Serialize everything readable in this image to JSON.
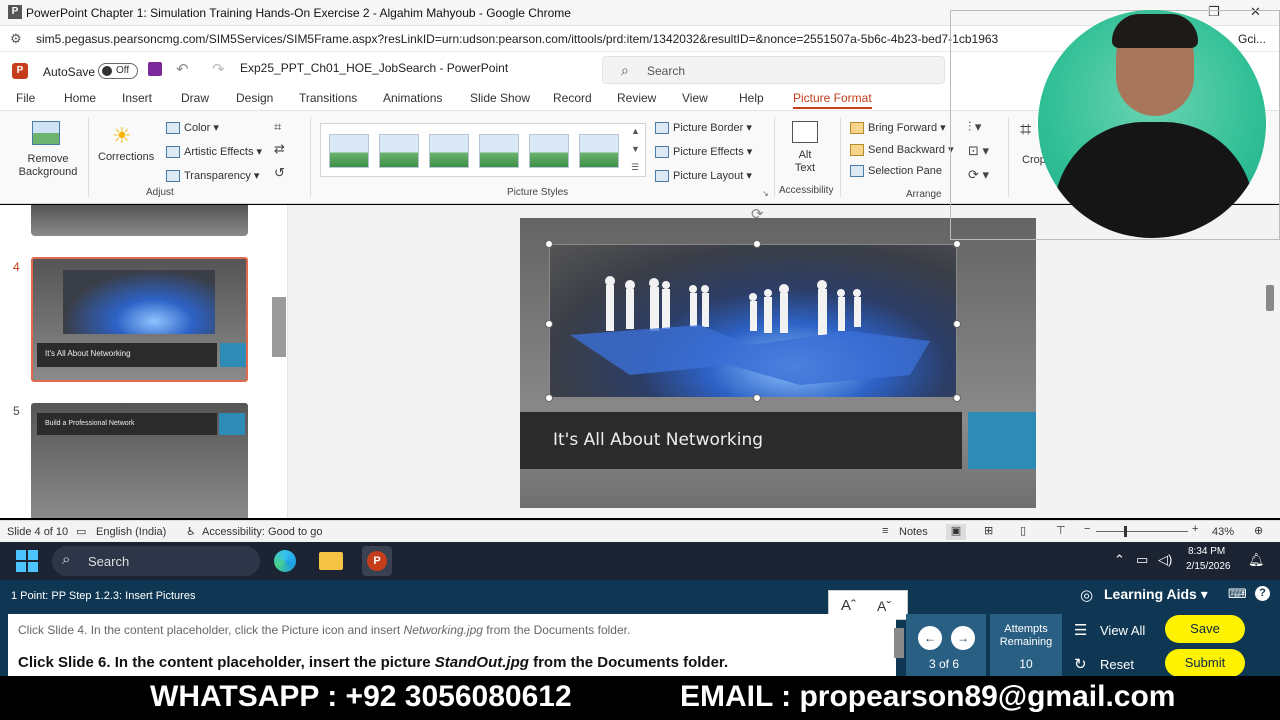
{
  "browser": {
    "window_title": "PowerPoint Chapter 1: Simulation Training Hands-On Exercise 2 - Algahim Mahyoub - Google Chrome",
    "url": "sim5.pegasus.pearsoncmg.com/SIM5Services/SIM5Frame.aspx?resLinkID=urn:udson:pearson.com/ittools/prd:item/1342032&resultID=&nonce=2551507a-5b6c-4b23-bed7-1cb1963",
    "url_tail": "Gci..."
  },
  "ppt": {
    "autosave_label": "AutoSave",
    "autosave_state": "Off",
    "filename": "Exp25_PPT_Ch01_HOE_JobSearch - PowerPoint",
    "search_placeholder": "Search"
  },
  "tabs": [
    "File",
    "Home",
    "Insert",
    "Draw",
    "Design",
    "Transitions",
    "Animations",
    "Slide Show",
    "Record",
    "Review",
    "View",
    "Help",
    "Picture Format"
  ],
  "ribbon": {
    "remove_background": "Remove Background",
    "corrections": "Corrections",
    "color": "Color",
    "artistic_effects": "Artistic Effects",
    "transparency": "Transparency",
    "adjust_group": "Adjust",
    "picture_styles_group": "Picture Styles",
    "picture_border": "Picture Border",
    "picture_effects": "Picture Effects",
    "picture_layout": "Picture Layout",
    "alt_text": "Alt Text",
    "accessibility_group": "Accessibility",
    "bring_forward": "Bring Forward",
    "send_backward": "Send Backward",
    "selection_pane": "Selection Pane",
    "arrange_group": "Arrange",
    "crop": "Crop"
  },
  "slides_panel": {
    "slide4_number": "4",
    "slide4_title": "It's All About Networking",
    "slide5_number": "5",
    "slide5_title": "Build a Professional Network"
  },
  "slide": {
    "title": "It's All About Networking"
  },
  "statusbar": {
    "slide_info": "Slide 4 of 10",
    "language": "English (India)",
    "accessibility": "Accessibility: Good to go",
    "notes": "Notes",
    "zoom": "43%"
  },
  "taskbar": {
    "search": "Search",
    "time": "8:34 PM",
    "date": "2/15/2026"
  },
  "sim": {
    "step": "1 Point: PP Step 1.2.3: Insert Pictures",
    "learning_aids": "Learning Aids",
    "font_up": "Aˆ",
    "font_down": "Aˇ",
    "prev_instruction_a": "Click Slide 4. In the content placeholder, click the Picture icon and insert ",
    "prev_instruction_file": "Networking.jpg",
    "prev_instruction_b": " from the Documents folder.",
    "instruction_a": "Click Slide 6. In the content placeholder, insert the picture ",
    "instruction_file": "StandOut.jpg",
    "instruction_b": " from the Documents folder.",
    "page_indicator": "3 of 6",
    "attempts_label": "Attempts Remaining",
    "attempts_value": "10",
    "view_all": "View All",
    "reset": "Reset",
    "save": "Save",
    "submit": "Submit"
  },
  "footer": {
    "whatsapp": "WHATSAPP : +92 3056080612",
    "email": "EMAIL : propearson89@gmail.com"
  },
  "colors": {
    "accent": "#c43e1c",
    "sim_bg": "#0f3753",
    "button_yellow": "#fff200",
    "slide_accent": "#2d8bb5"
  }
}
